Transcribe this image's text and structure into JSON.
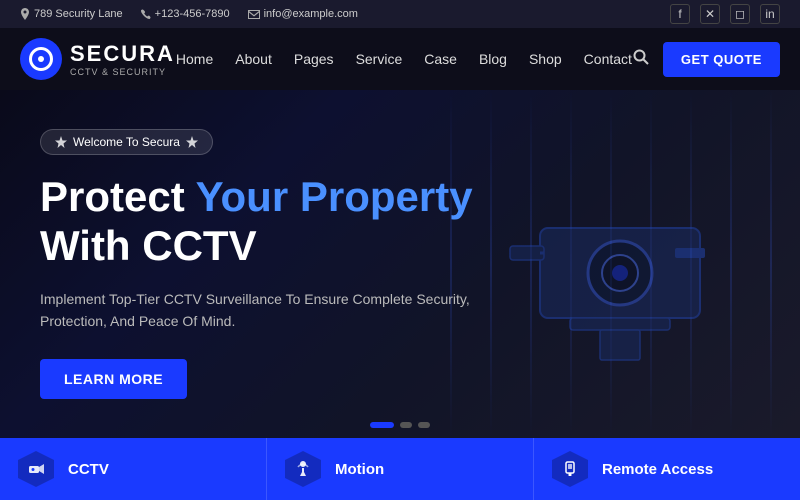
{
  "topbar": {
    "address": "789 Security Lane",
    "phone": "+123-456-7890",
    "email": "info@example.com",
    "socials": [
      "f",
      "𝕏",
      "📷",
      "in"
    ]
  },
  "navbar": {
    "logo_brand": "SECURA",
    "logo_sub": "CCTV & SECURITY",
    "nav_links": [
      "Home",
      "About",
      "Pages",
      "Service",
      "Case",
      "Blog",
      "Shop",
      "Contact"
    ],
    "get_quote": "GET QUOTE"
  },
  "hero": {
    "welcome_badge": "Welcome To Secura",
    "title_line1_plain": "Protect ",
    "title_line1_accent": "Your Property",
    "title_line2": "With CCTV",
    "description": "Implement Top-Tier CCTV Surveillance To Ensure Complete Security, Protection, And Peace Of Mind.",
    "cta_label": "LEARN MORE"
  },
  "cards": [
    {
      "icon": "📹",
      "title": "CCTV"
    },
    {
      "icon": "🔔",
      "title": "Motion"
    },
    {
      "icon": "🔒",
      "title": "Remote Access"
    }
  ]
}
